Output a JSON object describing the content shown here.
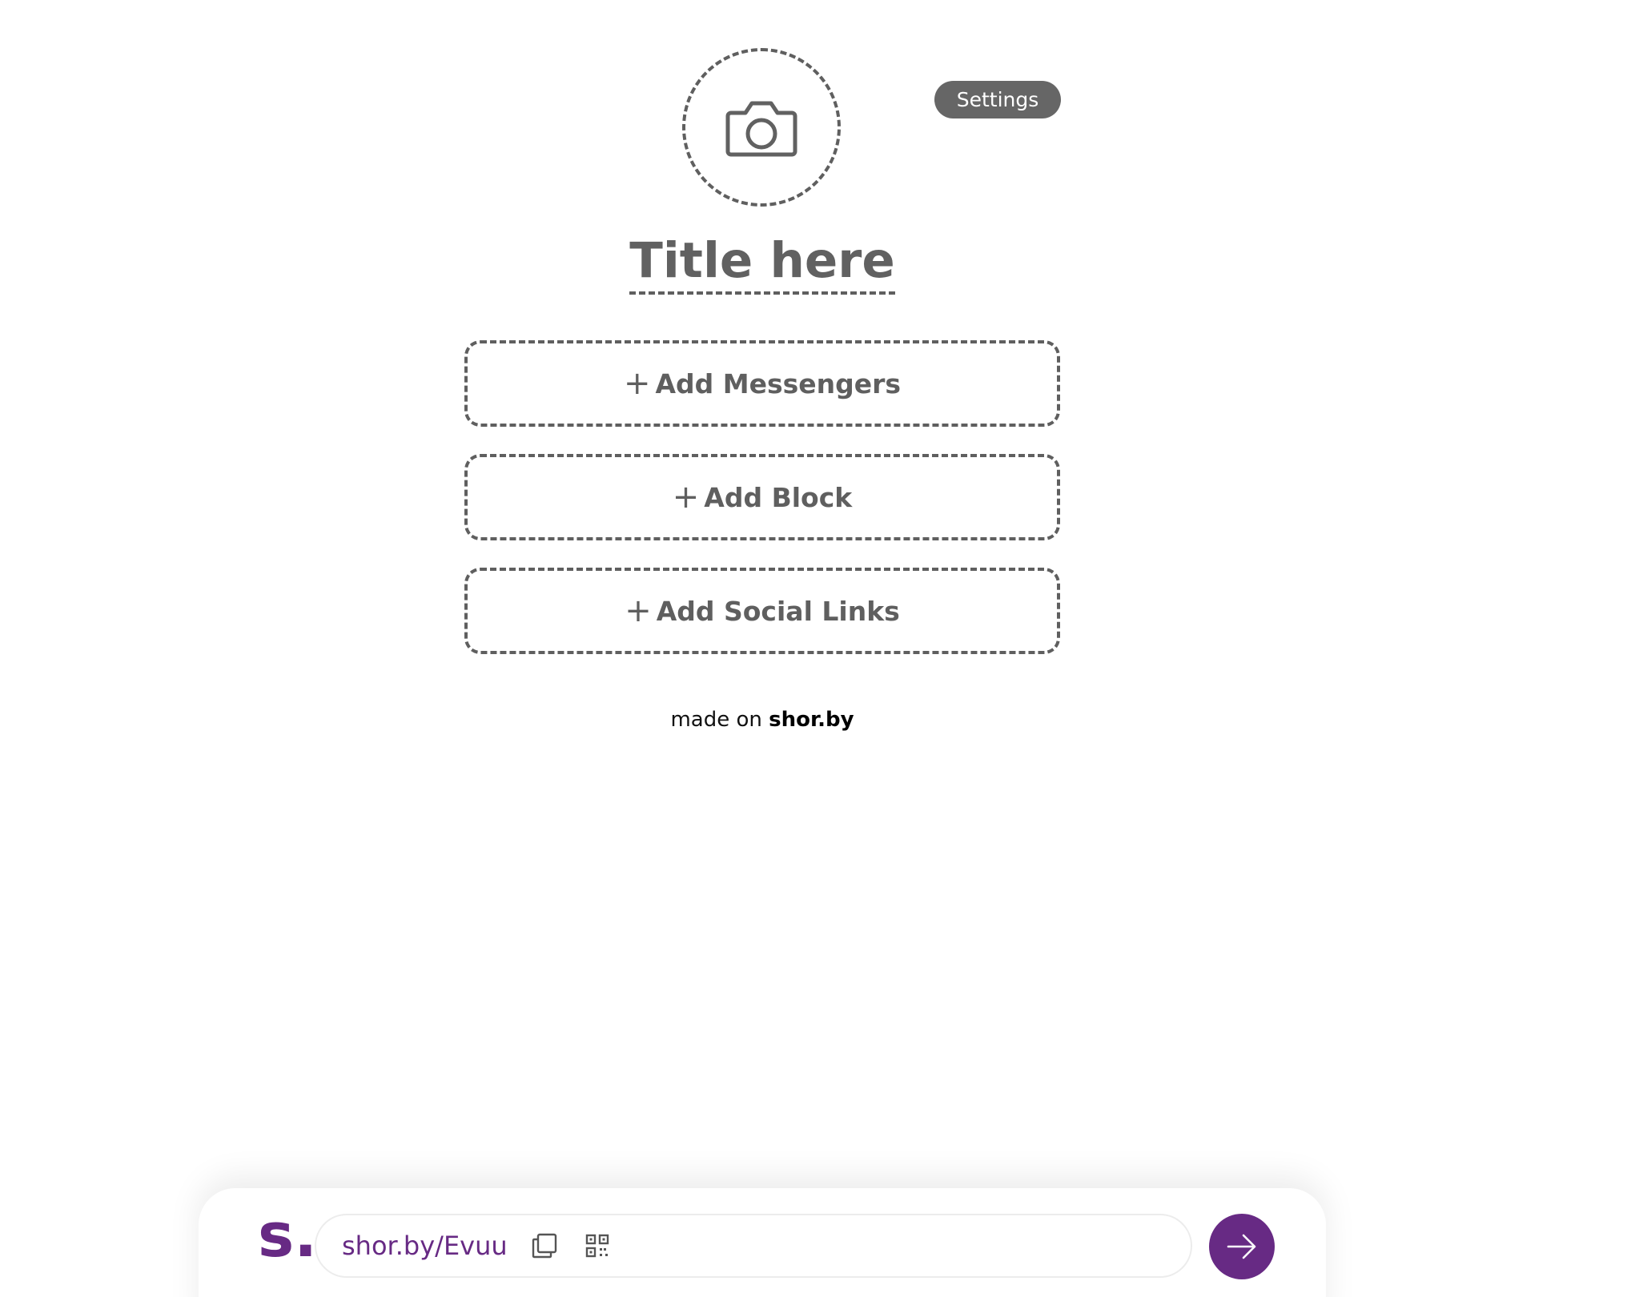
{
  "profile": {
    "title": "Title here",
    "settings_label": "Settings",
    "avatar_icon": "camera-icon"
  },
  "actions": [
    {
      "label": "Add Messengers",
      "icon": "plus-icon"
    },
    {
      "label": "Add Block",
      "icon": "plus-icon"
    },
    {
      "label": "Add Social Links",
      "icon": "plus-icon"
    }
  ],
  "footer": {
    "made_on_prefix": "made on",
    "made_on_brand": "shor.by"
  },
  "bottom_bar": {
    "logo": "s.",
    "short_url": "shor.by/Evuu",
    "copy_icon": "copy-icon",
    "qr_icon": "qr-code-icon",
    "go_icon": "arrow-right-icon"
  },
  "colors": {
    "brand": "#672a84",
    "dashed_gray": "#5f5f5f",
    "settings_bg": "#666666"
  }
}
